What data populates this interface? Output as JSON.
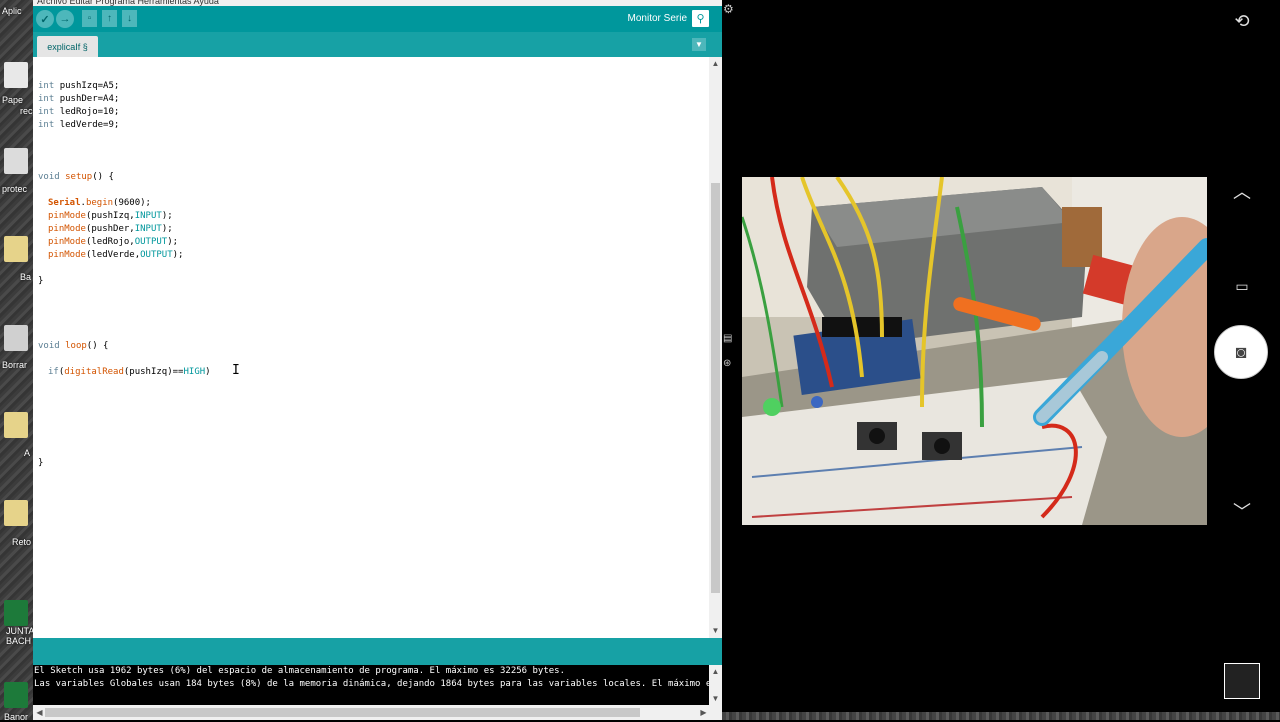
{
  "desktop": {
    "labels": [
      "Aplic",
      "Pape",
      "rec",
      "protec",
      "Ba",
      "Borrar",
      "A",
      "Reto",
      "JUNTA",
      "BACH",
      "Banor"
    ]
  },
  "ide": {
    "menu_text": "Archivo  Editar  Programa  Herramientas  Ayuda",
    "toolbar": {
      "verify_icon": "check-icon",
      "upload_icon": "right-arrow-icon",
      "new_icon": "new-file-icon",
      "open_icon": "up-arrow-icon",
      "save_icon": "down-arrow-icon",
      "serial_monitor_label": "Monitor Serie",
      "serial_monitor_icon": "magnifier-icon"
    },
    "tab": {
      "label": "explicaIf §"
    },
    "code": [
      "int pushIzq=A5;",
      "int pushDer=A4;",
      "int ledRojo=10;",
      "int ledVerde=9;",
      "void setup() {",
      "Serial.begin(9600);",
      "pinMode(pushIzq,INPUT);",
      "pinMode(pushDer,INPUT);",
      "pinMode(ledRojo,OUTPUT);",
      "pinMode(ledVerde,OUTPUT);",
      "}",
      "void loop() {",
      "if(digitalRead(pushIzq)==HIGH)",
      "}"
    ],
    "console": [
      "El Sketch usa 1962 bytes (6%) del espacio de almacenamiento de programa. El máximo es 32256 bytes.",
      "Las variables Globales usan 184 bytes (8%) de la memoria dinámica, dejando 1864 bytes para las variables locales. El máximo es"
    ]
  },
  "camera": {
    "settings_icon": "camera-settings-icon",
    "up_icon": "chevron-up-icon",
    "video_icon": "video-icon",
    "shutter_icon": "camera-icon",
    "down_icon": "chevron-down-icon",
    "gallery_icon": "gallery-thumbnail"
  },
  "colors": {
    "arduino_teal": "#00979c",
    "tab_teal": "#17a1a5",
    "keyword": "#5c7f93",
    "function": "#d35400"
  }
}
